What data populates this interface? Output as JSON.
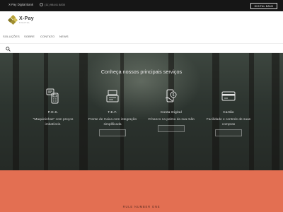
{
  "topbar": {
    "brand_line": "X-Pay Digital Bank",
    "phone": "(11) 98441 8830",
    "cta_label": "DIGITAL BANK"
  },
  "logo": {
    "name": "X-Pay",
    "tagline": "DIGITAL"
  },
  "nav": {
    "items": [
      {
        "label": "SOLUÇÕES"
      },
      {
        "label": "SOBRE"
      },
      {
        "label": "CONTATO"
      },
      {
        "label": "NEWS"
      }
    ]
  },
  "hero": {
    "heading": "Conheça nossos principais serviços",
    "services": [
      {
        "icon": "pos-terminal-icon",
        "title": "P.O.S.",
        "desc": "\"Maquininhas\" com preços imbatíveis."
      },
      {
        "icon": "tef-register-icon",
        "title": "T.E.F.",
        "desc": "Frente de Caixa com integração simplificada"
      },
      {
        "icon": "mobile-bank-icon",
        "title": "Conta Digital",
        "desc": "O banco na palma da sua mão"
      },
      {
        "icon": "credit-card-icon",
        "title": "Cartão",
        "desc": "Facilidade e controle de suas compras"
      }
    ]
  },
  "footer_band": {
    "rule_text": "RULE NUMBER ONE"
  },
  "colors": {
    "accent": "#e36f52",
    "logo_gold": "#b8a33a",
    "topbar": "#161616"
  }
}
